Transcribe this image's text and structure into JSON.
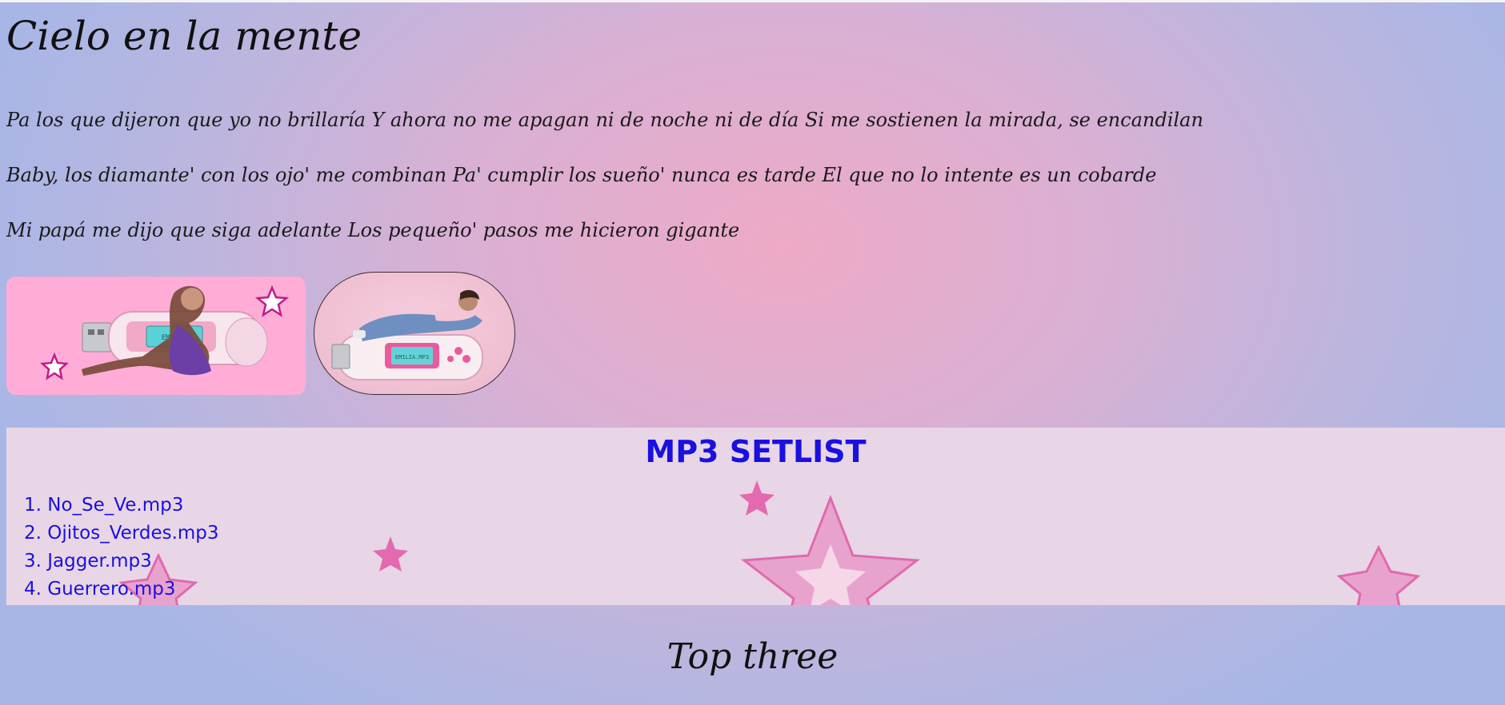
{
  "page": {
    "title": "Cielo en la mente",
    "lyrics": [
      "Pa los que dijeron que yo no brillaría Y ahora no me apagan ni de noche ni de día Si me sostienen la mirada, se encandilan",
      "Baby, los diamante' con los ojo' me combinan Pa' cumplir los sueño' nunca es tarde El que no lo intente es un cobarde",
      "Mi papá me dijo que siga adelante Los pequeño' pasos me hicieron gigante"
    ],
    "images": [
      {
        "name": "mp3-player-photo-pink",
        "screen_text": "EMILIA"
      },
      {
        "name": "mp3-player-photo-oval",
        "screen_text": "EMILIA.MP3"
      }
    ]
  },
  "setlist": {
    "heading": "MP3 SETLIST",
    "tracks": [
      "1. No_Se_Ve.mp3",
      "2. Ojitos_Verdes.mp3",
      "3. Jagger.mp3",
      "4. Guerrero.mp3"
    ]
  },
  "top_three": {
    "heading": "Top three"
  },
  "colors": {
    "setlist_text": "#1a10e0",
    "star_pink": "#e98ac0",
    "image_bg": "#ffadd6"
  }
}
